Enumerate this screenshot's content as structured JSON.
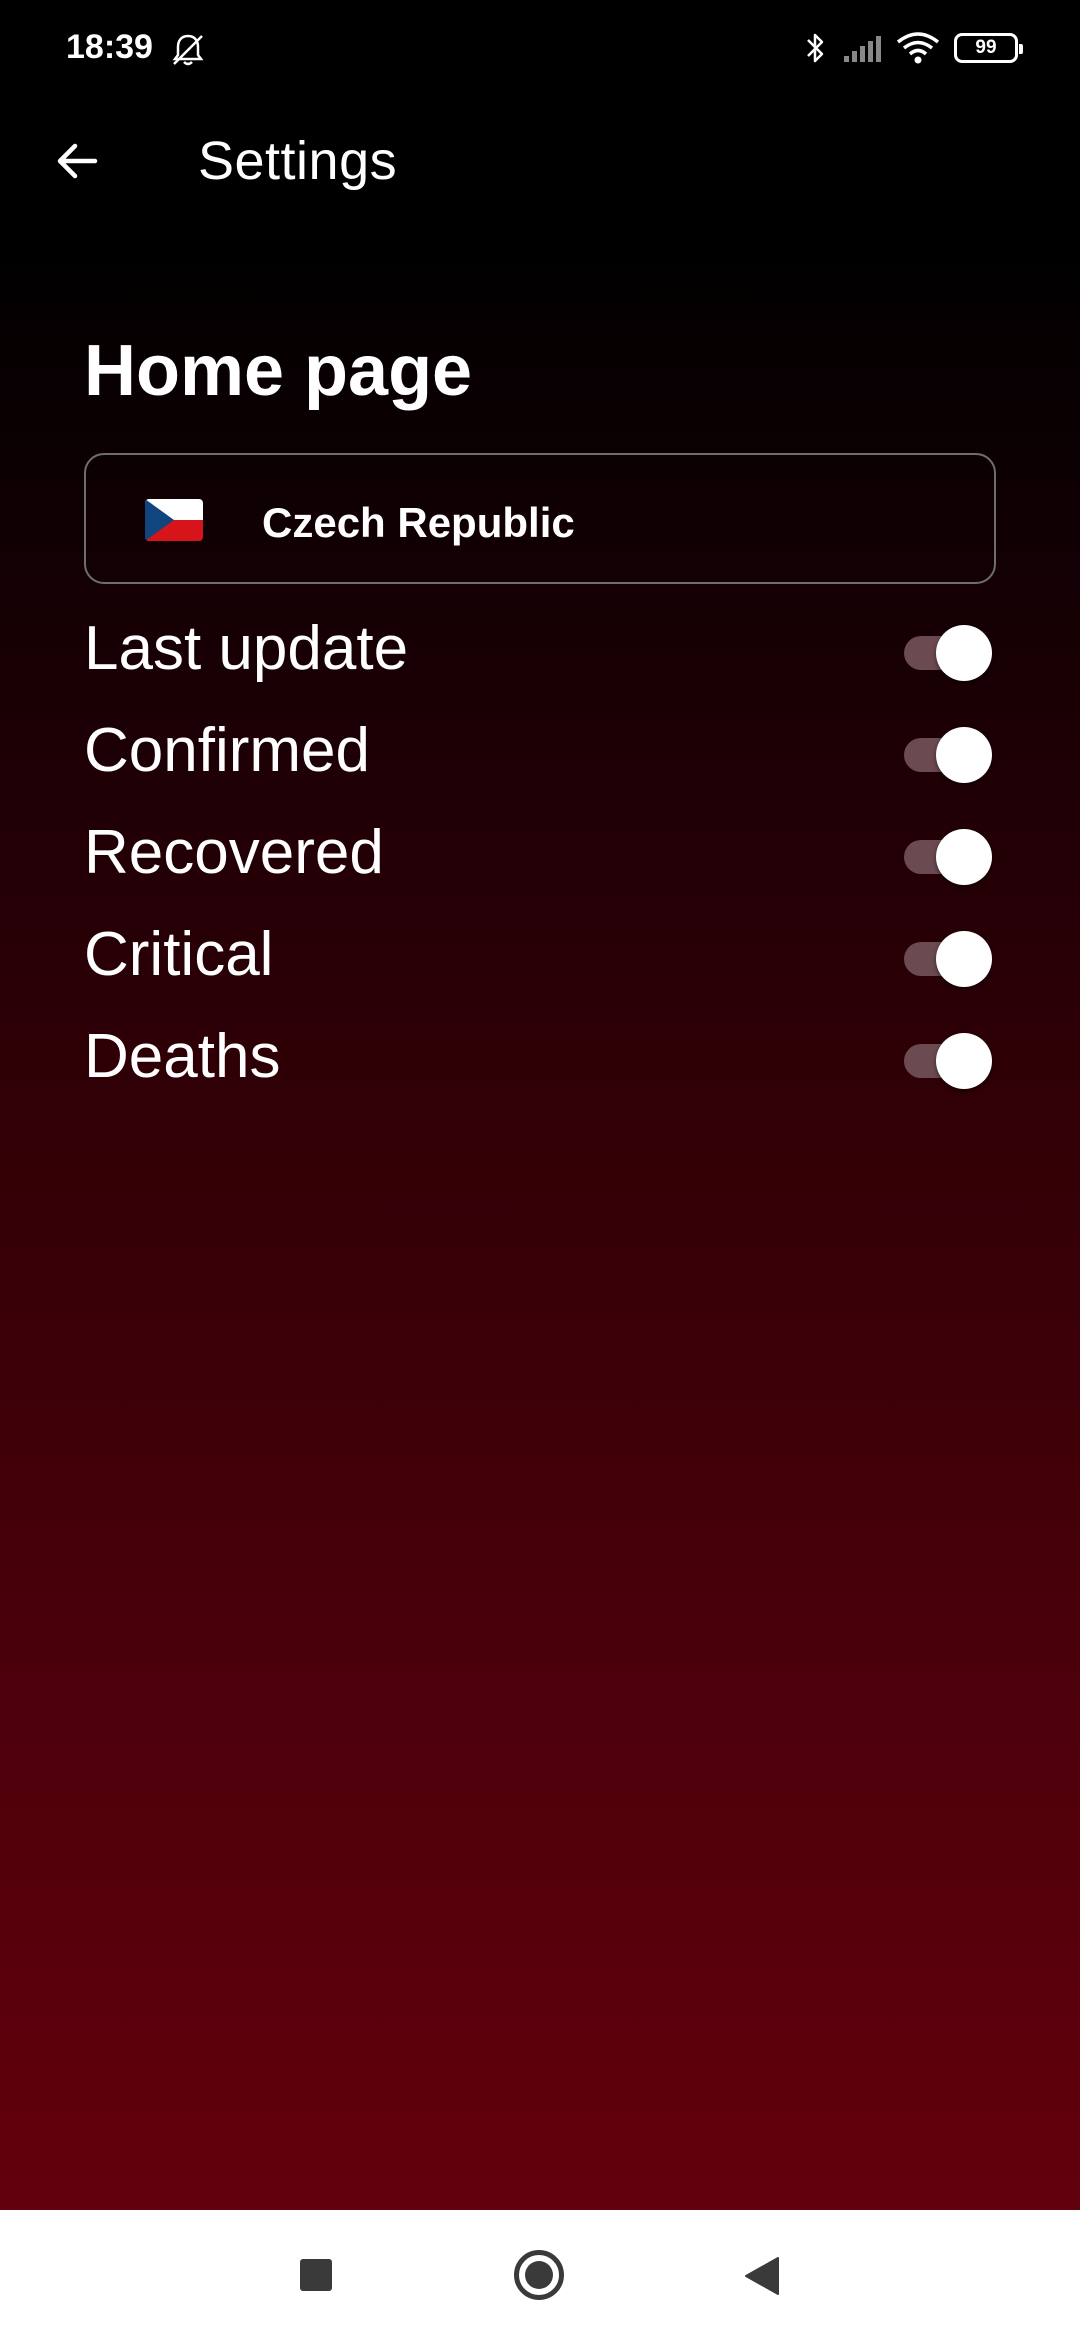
{
  "status_bar": {
    "time": "18:39",
    "battery": "99",
    "icons": [
      "bell-off-icon",
      "bluetooth-icon",
      "signal-icon",
      "wifi-icon",
      "battery-icon"
    ]
  },
  "app_bar": {
    "title": "Settings",
    "back_icon": "arrow-back-icon"
  },
  "home_page": {
    "title": "Home page",
    "country": {
      "flag": "czech-flag",
      "name": "Czech Republic"
    },
    "toggles": [
      {
        "label": "Last update",
        "on": true
      },
      {
        "label": "Confirmed",
        "on": true
      },
      {
        "label": "Recovered",
        "on": true
      },
      {
        "label": "Critical",
        "on": true
      },
      {
        "label": "Deaths",
        "on": true
      }
    ]
  },
  "colors": {
    "background_top": "#000000",
    "background_bottom": "#63000d",
    "switch_track": "#6b4a52",
    "switch_thumb": "#ffffff",
    "select_border": "#6e6e6e"
  },
  "nav_bar": {
    "icons": [
      "recents-icon",
      "home-icon",
      "back-icon"
    ]
  }
}
